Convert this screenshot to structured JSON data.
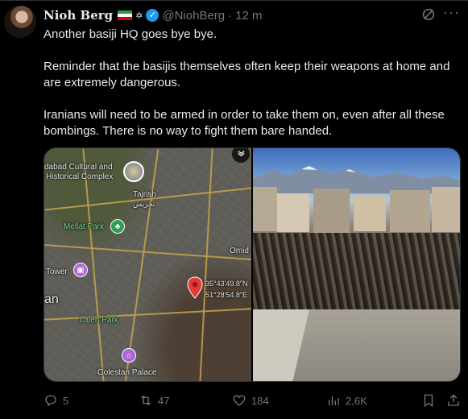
{
  "author": {
    "name": "Nioh Berg",
    "star": "✡",
    "verified": "✓",
    "handle": "@NiohBerg",
    "separator": "·",
    "time": "12 m"
  },
  "tweet": {
    "paragraphs": [
      "Another basiji HQ goes bye bye.",
      "Reminder that the basijis themselves often keep their weapons at home and are extremely dangerous.",
      "Iranians will need to be armed in order to take them on, even after all these bombings. There is no way to fight them bare handed."
    ]
  },
  "map": {
    "labels": {
      "complex_line1": "dabad Cultural and",
      "complex_line2": "Historical Complex",
      "tajrish": "Tajrish",
      "tajrish_fa": "تجریش",
      "mellat": "Mellat Park",
      "omid": "Omid",
      "tower": "Tower",
      "city": "an",
      "laleh": "Laleh Park",
      "golestan": "Golestan Palace",
      "coord1": "35°43'49.8\"N",
      "coord2": "51°28'54.8\"E"
    }
  },
  "actions": {
    "replies": "5",
    "reposts": "47",
    "likes": "184",
    "views": "2,6K"
  },
  "colors": {
    "background": "#000000",
    "text": "#e7e9ea",
    "muted": "#71767b",
    "verified": "#1d9bf0",
    "pin": "#e53935",
    "park_icon": "#2e9e4f",
    "poi_icon": "#b065d6"
  },
  "icons": {
    "verified": "verified-badge-icon",
    "grok": "grok-icon",
    "more": "more-icon",
    "gallery": "image-gallery-icon",
    "reply": "reply-icon",
    "repost": "repost-icon",
    "like": "heart-icon",
    "views": "views-icon",
    "bookmark": "bookmark-icon",
    "share": "share-icon"
  }
}
